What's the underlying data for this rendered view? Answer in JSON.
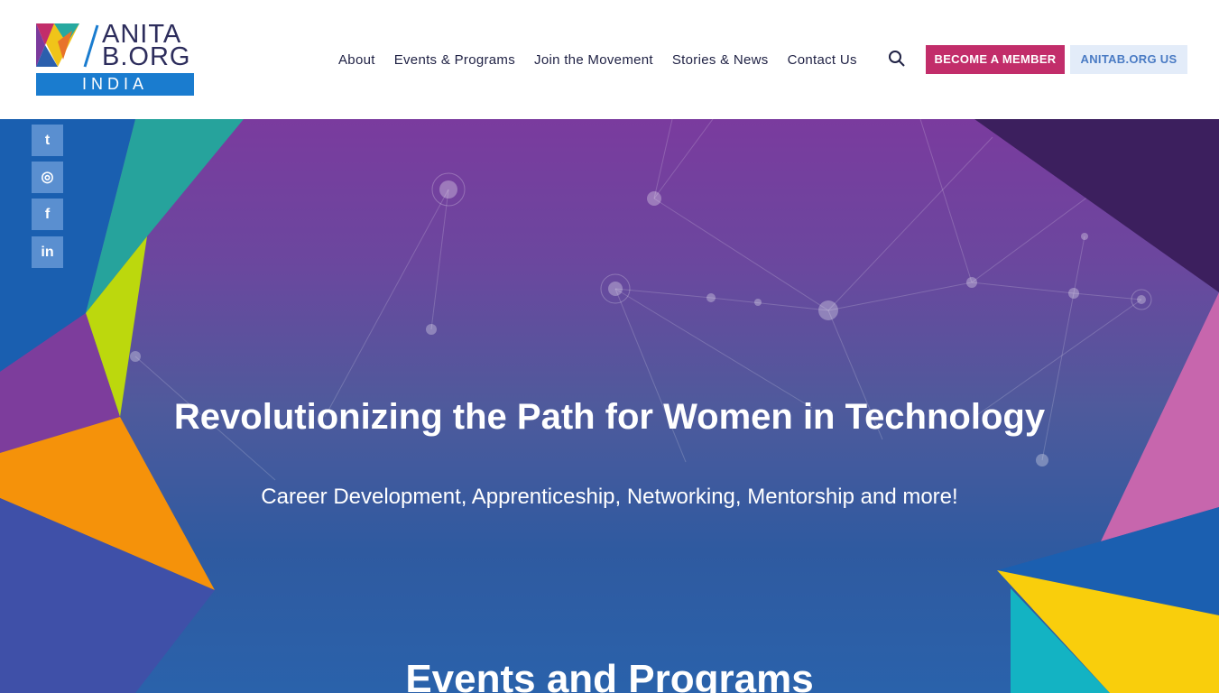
{
  "logo": {
    "line1": "ANITA",
    "line2": "B.ORG",
    "line3": "INDIA"
  },
  "nav": {
    "items": [
      "About",
      "Events & Programs",
      "Join the Movement",
      "Stories & News",
      "Contact Us"
    ]
  },
  "buttons": {
    "member": "BECOME A MEMBER",
    "us": "ANITAB.ORG US"
  },
  "social": [
    {
      "icon": "twitter-icon",
      "glyph": "t"
    },
    {
      "icon": "instagram-icon",
      "glyph": "◎"
    },
    {
      "icon": "facebook-icon",
      "glyph": "f"
    },
    {
      "icon": "linkedin-icon",
      "glyph": "in"
    }
  ],
  "hero": {
    "title": "Revolutionizing the Path for Women in Technology",
    "subtitle": "Career Development, Apprenticeship, Networking, Mentorship and more!"
  },
  "events": {
    "title": "Events and Programs"
  },
  "colors": {
    "member_button": "#c22d6a",
    "us_button_bg": "#e3ecf9",
    "india_bar": "#1a7ccf"
  }
}
